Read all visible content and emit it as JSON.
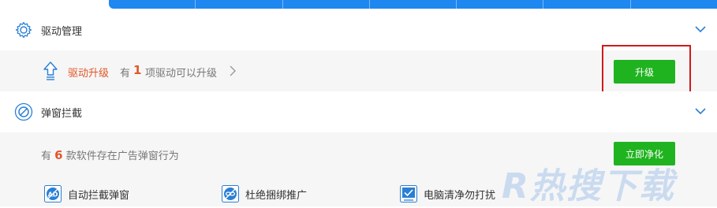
{
  "tabbar": {
    "segment_count": 7,
    "color": "#1e87f0"
  },
  "driver_section": {
    "title": "驱动管理",
    "icon": "gear-icon",
    "upgrade": {
      "name": "驱动升级",
      "has": "有",
      "count": "1",
      "rest": "项驱动可以升级",
      "button_label": "升级"
    }
  },
  "popup_section": {
    "title": "弹窗拦截",
    "icon": "block-icon",
    "summary_prefix": "有",
    "summary_count": "6",
    "summary_suffix": "款软件存在广告弹窗行为",
    "button_label": "立即净化",
    "features": [
      {
        "label": "自动拦截弹窗",
        "icon": "ad-block-icon"
      },
      {
        "label": "杜绝捆绑推广",
        "icon": "link-block-icon"
      },
      {
        "label": "电脑清净勿打扰",
        "icon": "check-box-icon"
      }
    ]
  },
  "colors": {
    "accent_blue": "#1e87f0",
    "button_green": "#1fb31f",
    "highlight_orange": "#e0572a",
    "annotation_red": "#d01a1a"
  },
  "watermark": {
    "text": "R热搜下载"
  }
}
